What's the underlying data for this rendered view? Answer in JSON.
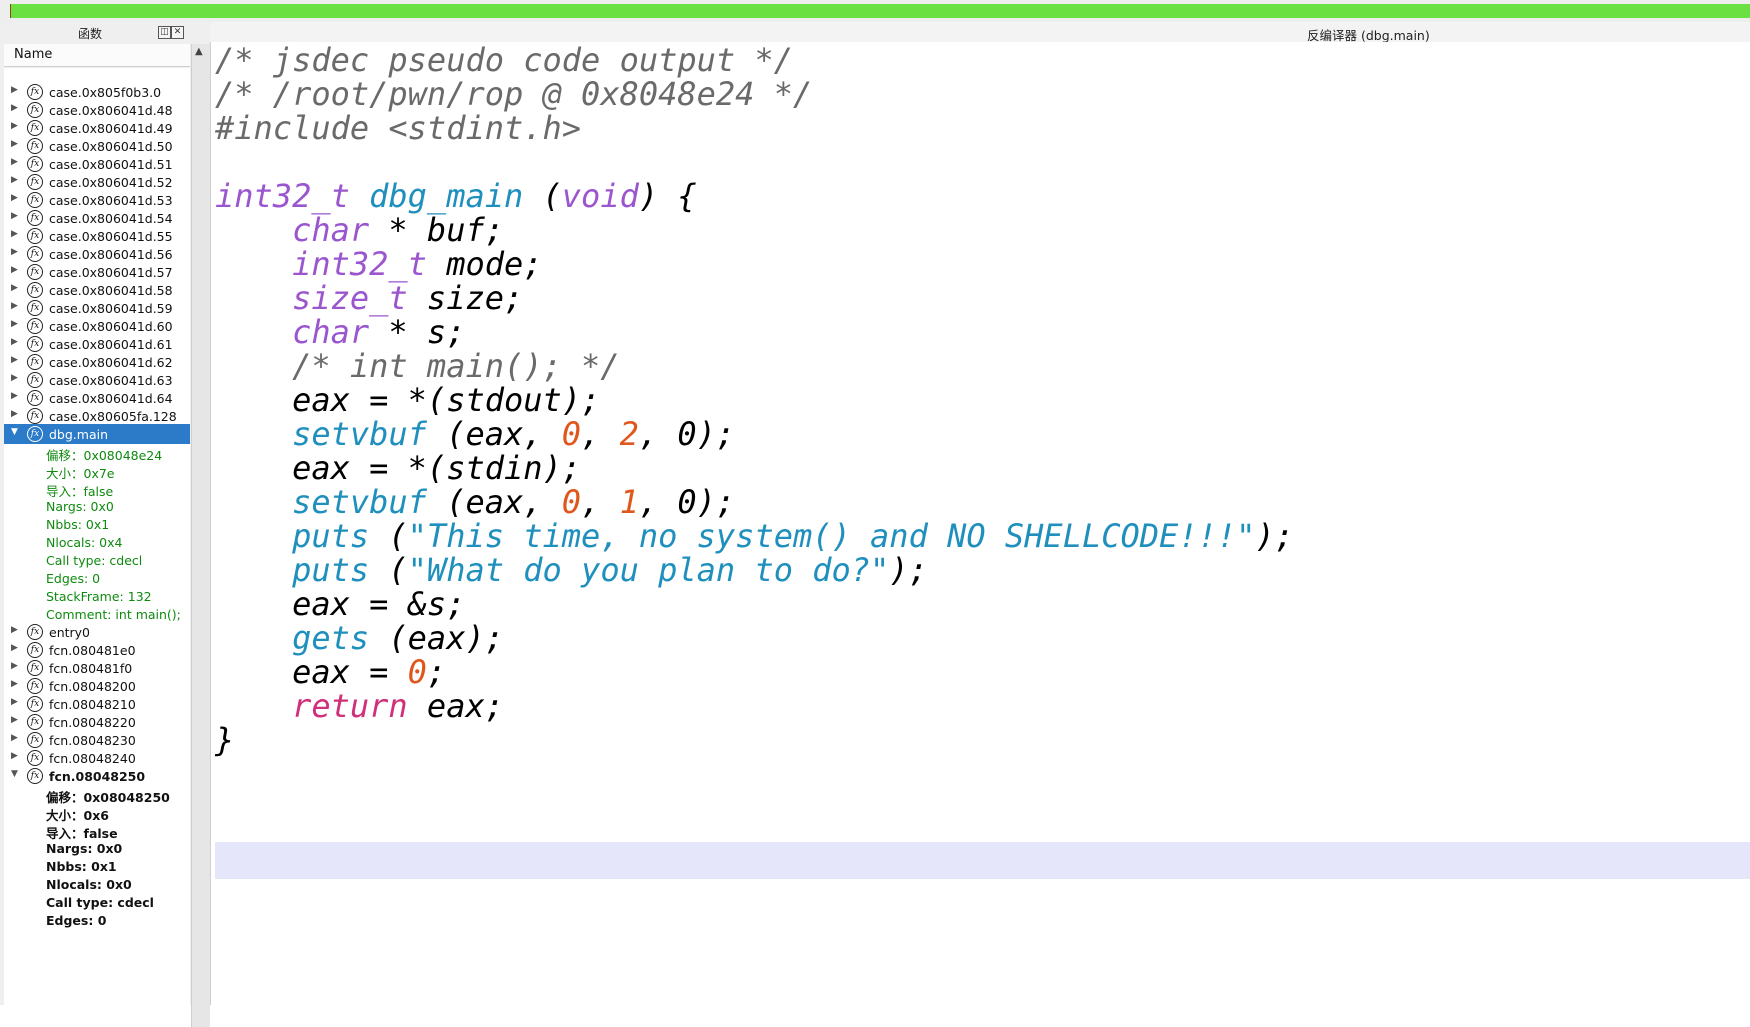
{
  "progress": {
    "fraction": 1.0,
    "color": "#6be043"
  },
  "functions_panel": {
    "title": "函数",
    "column_header": "Name",
    "items": [
      "case.0x805f0b3.0",
      "case.0x806041d.48",
      "case.0x806041d.49",
      "case.0x806041d.50",
      "case.0x806041d.51",
      "case.0x806041d.52",
      "case.0x806041d.53",
      "case.0x806041d.54",
      "case.0x806041d.55",
      "case.0x806041d.56",
      "case.0x806041d.57",
      "case.0x806041d.58",
      "case.0x806041d.59",
      "case.0x806041d.60",
      "case.0x806041d.61",
      "case.0x806041d.62",
      "case.0x806041d.63",
      "case.0x806041d.64",
      "case.0x80605fa.128"
    ],
    "selected": {
      "name": "dbg.main",
      "props": [
        "偏移：0x08048e24",
        "大小：0x7e",
        "导入：false",
        "Nargs: 0x0",
        "Nbbs: 0x1",
        "Nlocals: 0x4",
        "Call type: cdecl",
        "Edges: 0",
        "StackFrame: 132",
        "Comment: int main();"
      ]
    },
    "items_after": [
      "entry0",
      "fcn.080481e0",
      "fcn.080481f0",
      "fcn.08048200",
      "fcn.08048210",
      "fcn.08048220",
      "fcn.08048230",
      "fcn.08048240"
    ],
    "expanded": {
      "name": "fcn.08048250",
      "props": [
        "偏移：0x08048250",
        "大小：0x6",
        "导入：false",
        "Nargs: 0x0",
        "Nbbs: 0x1",
        "Nlocals: 0x0",
        "Call type: cdecl",
        "Edges: 0"
      ]
    }
  },
  "decompiler": {
    "title": "反编译器 (dbg.main)",
    "lines": [
      [
        [
          "cm",
          "/* jsdec pseudo code output */"
        ]
      ],
      [
        [
          "cm",
          "/* /root/pwn/rop @ 0x8048e24 */"
        ]
      ],
      [
        [
          "cm",
          "#include <stdint.h>"
        ]
      ],
      [],
      [
        [
          "ty",
          "int32_t"
        ],
        [
          "pl",
          " "
        ],
        [
          "fn",
          "dbg_main"
        ],
        [
          "pl",
          " ("
        ],
        [
          "ty",
          "void"
        ],
        [
          "pl",
          ") {"
        ]
      ],
      [
        [
          "pl",
          "    "
        ],
        [
          "ty",
          "char"
        ],
        [
          "pl",
          " * buf;"
        ]
      ],
      [
        [
          "pl",
          "    "
        ],
        [
          "ty",
          "int32_t"
        ],
        [
          "pl",
          " mode;"
        ]
      ],
      [
        [
          "pl",
          "    "
        ],
        [
          "ty",
          "size_t"
        ],
        [
          "pl",
          " size;"
        ]
      ],
      [
        [
          "pl",
          "    "
        ],
        [
          "ty",
          "char"
        ],
        [
          "pl",
          " * s;"
        ]
      ],
      [
        [
          "pl",
          "    "
        ],
        [
          "cm",
          "/* int main(); */"
        ]
      ],
      [
        [
          "pl",
          "    eax = *(stdout);"
        ]
      ],
      [
        [
          "pl",
          "    "
        ],
        [
          "fn",
          "setvbuf"
        ],
        [
          "pl",
          " (eax, "
        ],
        [
          "nu",
          "0"
        ],
        [
          "pl",
          ", "
        ],
        [
          "nu",
          "2"
        ],
        [
          "pl",
          ", 0);"
        ]
      ],
      [
        [
          "pl",
          "    eax = *(stdin);"
        ]
      ],
      [
        [
          "pl",
          "    "
        ],
        [
          "fn",
          "setvbuf"
        ],
        [
          "pl",
          " (eax, "
        ],
        [
          "nu",
          "0"
        ],
        [
          "pl",
          ", "
        ],
        [
          "nu",
          "1"
        ],
        [
          "pl",
          ", 0);"
        ]
      ],
      [
        [
          "pl",
          "    "
        ],
        [
          "fn",
          "puts"
        ],
        [
          "pl",
          " ("
        ],
        [
          "st",
          "\"This time, no system() and NO SHELLCODE!!!\""
        ],
        [
          "pl",
          ");"
        ]
      ],
      [
        [
          "pl",
          "    "
        ],
        [
          "fn",
          "puts"
        ],
        [
          "pl",
          " ("
        ],
        [
          "st",
          "\"What do you plan to do?\""
        ],
        [
          "pl",
          ");"
        ]
      ],
      [
        [
          "pl",
          "    eax = &s;"
        ]
      ],
      [
        [
          "pl",
          "    "
        ],
        [
          "fn",
          "gets"
        ],
        [
          "pl",
          " (eax);"
        ]
      ],
      [
        [
          "pl",
          "    eax = "
        ],
        [
          "nu",
          "0"
        ],
        [
          "pl",
          ";"
        ]
      ],
      [
        [
          "pl",
          "    "
        ],
        [
          "kw",
          "return"
        ],
        [
          "pl",
          " eax;"
        ]
      ],
      [
        [
          "pl",
          "}"
        ]
      ]
    ]
  }
}
